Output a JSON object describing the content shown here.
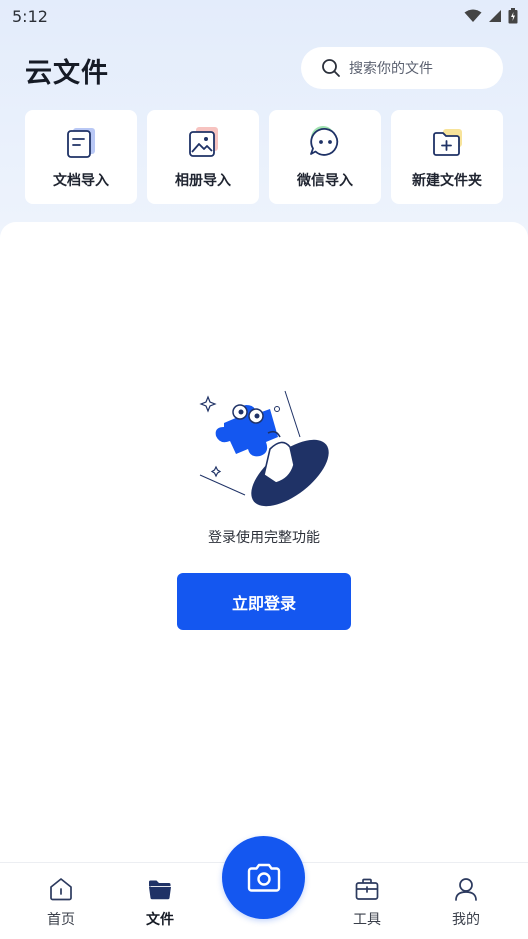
{
  "status_bar": {
    "time": "5:12"
  },
  "header": {
    "title": "云文件",
    "search": {
      "placeholder": "搜索你的文件",
      "icon": "search-icon"
    }
  },
  "quick_actions": [
    {
      "label": "文档导入",
      "icon": "document-icon"
    },
    {
      "label": "相册导入",
      "icon": "photo-album-icon"
    },
    {
      "label": "微信导入",
      "icon": "wechat-chat-icon"
    },
    {
      "label": "新建文件夹",
      "icon": "new-folder-icon"
    }
  ],
  "empty_state": {
    "message": "登录使用完整功能",
    "login_button": "立即登录",
    "illustration": "puzzle-piece-illustration"
  },
  "bottom_nav": {
    "items": [
      {
        "label": "首页",
        "icon": "home-icon",
        "active": false
      },
      {
        "label": "文件",
        "icon": "folder-icon",
        "active": true
      },
      {
        "label": "工具",
        "icon": "toolbox-icon",
        "active": false
      },
      {
        "label": "我的",
        "icon": "profile-icon",
        "active": false
      }
    ],
    "camera_icon": "camera-icon"
  },
  "colors": {
    "accent": "#1457f0",
    "navy": "#1f3266",
    "background": "#e8effb"
  }
}
